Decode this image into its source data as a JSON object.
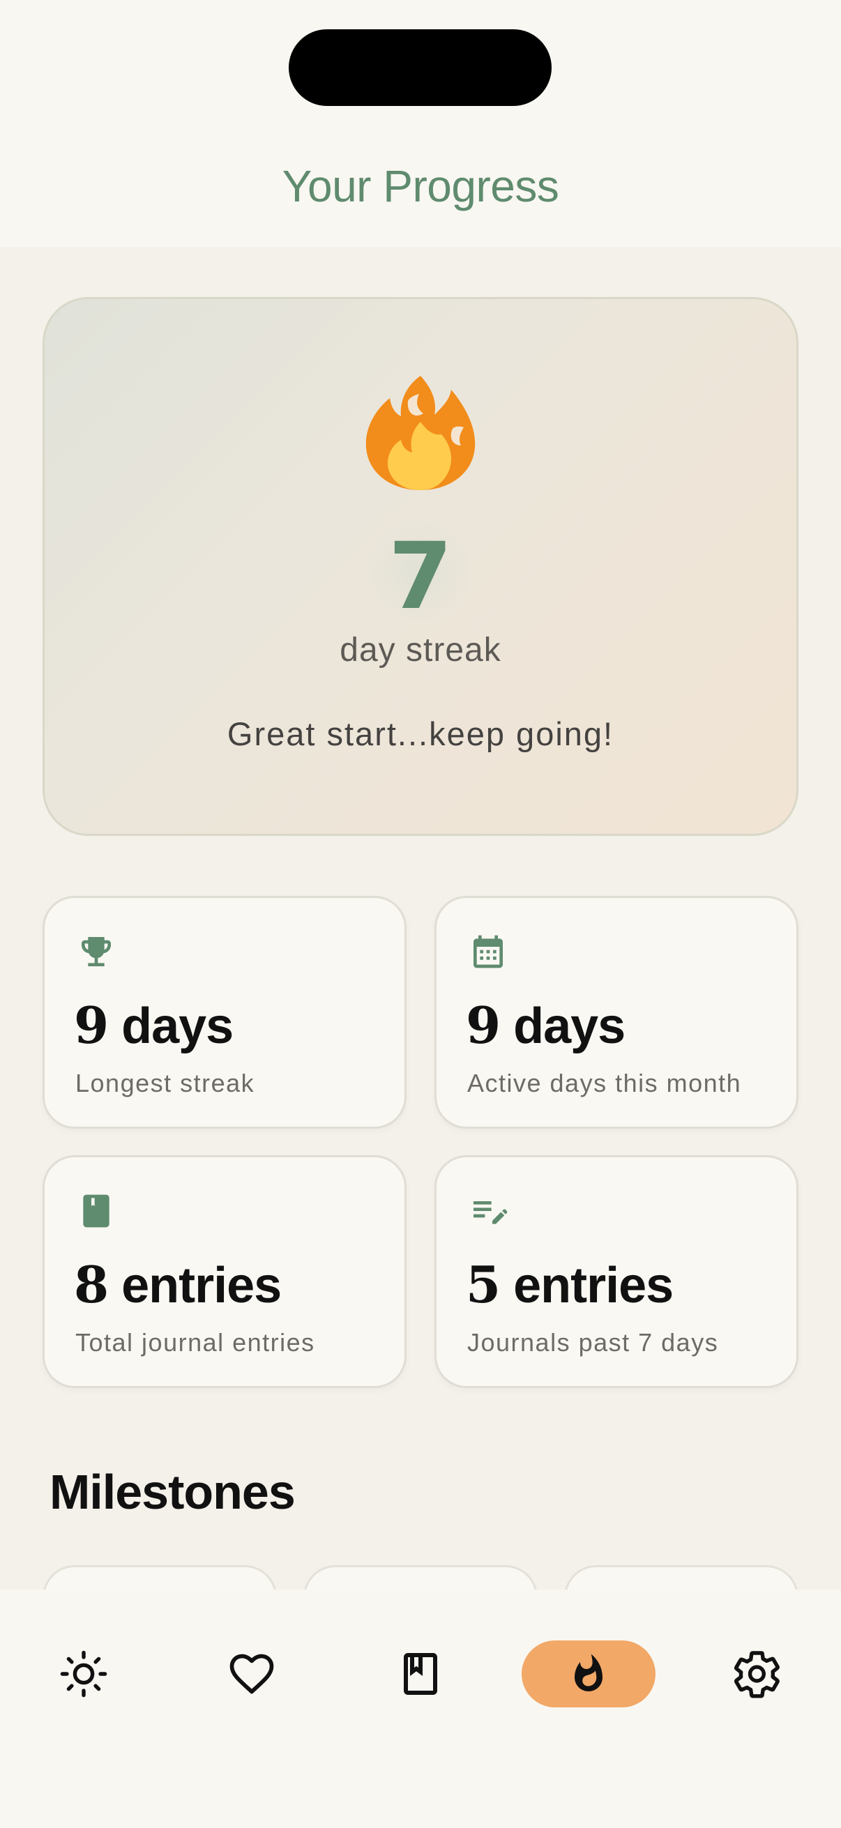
{
  "header": {
    "title": "Your Progress"
  },
  "streak": {
    "icon": "fire-icon",
    "count": "7",
    "label": "day streak",
    "message": "Great start...keep going!"
  },
  "stats": [
    {
      "icon": "trophy-icon",
      "value": "9",
      "unit": " days",
      "label": "Longest streak"
    },
    {
      "icon": "calendar-icon",
      "value": "9",
      "unit": " days",
      "label": "Active days this month"
    },
    {
      "icon": "journal-icon",
      "value": "8",
      "unit": " entries",
      "label": "Total journal entries"
    },
    {
      "icon": "edit-notes-icon",
      "value": "5",
      "unit": " entries",
      "label": "Journals past 7 days"
    }
  ],
  "milestones": {
    "title": "Milestones"
  },
  "nav": {
    "items": [
      {
        "icon": "sun-icon",
        "active": false
      },
      {
        "icon": "heart-icon",
        "active": false
      },
      {
        "icon": "book-icon",
        "active": false
      },
      {
        "icon": "flame-icon",
        "active": true
      },
      {
        "icon": "gear-icon",
        "active": false
      }
    ],
    "active_color": "#f2a867"
  },
  "colors": {
    "accent_green": "#5f8b6e",
    "background": "#f4f0ea",
    "card": "#faf8f3"
  }
}
